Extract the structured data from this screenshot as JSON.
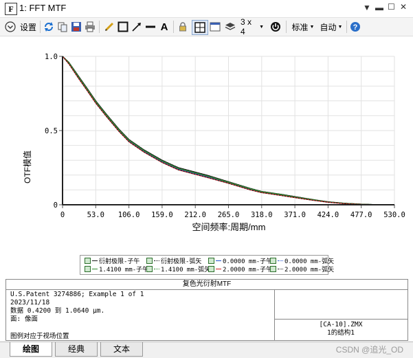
{
  "window": {
    "title": "1: FFT MTF",
    "icon_letter": "F"
  },
  "toolbar": {
    "settings_label": "设置",
    "layout_label": "3 x 4",
    "standard_label": "标准",
    "auto_label": "自动"
  },
  "chart_data": {
    "type": "line",
    "xlabel": "空间频率:周期/mm",
    "ylabel": "OTF模值",
    "xlim": [
      0,
      530
    ],
    "ylim": [
      0,
      1.0
    ],
    "x_ticks": [
      "0",
      "53.0",
      "106.0",
      "159.0",
      "212.0",
      "265.0",
      "318.0",
      "371.0",
      "424.0",
      "477.0",
      "530.0"
    ],
    "y_ticks": [
      "0",
      "0.5",
      "1.0"
    ],
    "grid": true,
    "x": [
      0,
      10,
      25,
      40,
      53,
      70,
      90,
      106,
      130,
      159,
      185,
      212,
      230,
      265,
      300,
      318,
      350,
      371,
      400,
      424,
      450,
      477,
      500,
      515,
      530
    ],
    "series": [
      {
        "name": "衍射极限-子午",
        "color": "#1a1a1a",
        "style": "solid",
        "values": [
          1.0,
          0.96,
          0.87,
          0.78,
          0.7,
          0.61,
          0.51,
          0.44,
          0.37,
          0.3,
          0.25,
          0.22,
          0.2,
          0.155,
          0.11,
          0.09,
          0.07,
          0.055,
          0.035,
          0.02,
          0.01,
          0.004,
          0.001,
          0.0,
          0.0
        ]
      },
      {
        "name": "衍射极限-弧矢",
        "color": "#1a1a1a",
        "style": "dotted",
        "values": [
          1.0,
          0.96,
          0.87,
          0.78,
          0.7,
          0.61,
          0.51,
          0.44,
          0.37,
          0.3,
          0.25,
          0.22,
          0.2,
          0.155,
          0.11,
          0.09,
          0.07,
          0.055,
          0.035,
          0.02,
          0.01,
          0.004,
          0.001,
          0.0,
          0.0
        ]
      },
      {
        "name": "0.0000 mm-子午",
        "color": "#1f4fd0",
        "style": "solid",
        "values": [
          1.0,
          0.955,
          0.86,
          0.77,
          0.69,
          0.6,
          0.5,
          0.43,
          0.36,
          0.29,
          0.24,
          0.21,
          0.19,
          0.15,
          0.105,
          0.085,
          0.065,
          0.05,
          0.032,
          0.018,
          0.009,
          0.003,
          0.001,
          0.0,
          0.0
        ]
      },
      {
        "name": "0.0000 mm-弧矢",
        "color": "#1f4fd0",
        "style": "dotted",
        "values": [
          1.0,
          0.955,
          0.86,
          0.77,
          0.69,
          0.6,
          0.5,
          0.43,
          0.36,
          0.29,
          0.24,
          0.21,
          0.19,
          0.15,
          0.105,
          0.085,
          0.065,
          0.05,
          0.032,
          0.018,
          0.009,
          0.003,
          0.001,
          0.0,
          0.0
        ]
      },
      {
        "name": "1.4100 mm-子午",
        "color": "#2e8b2e",
        "style": "solid",
        "values": [
          1.0,
          0.958,
          0.865,
          0.775,
          0.695,
          0.605,
          0.505,
          0.435,
          0.365,
          0.295,
          0.245,
          0.215,
          0.195,
          0.152,
          0.108,
          0.088,
          0.068,
          0.052,
          0.034,
          0.019,
          0.01,
          0.004,
          0.001,
          0.0,
          0.0
        ]
      },
      {
        "name": "1.4100 mm-弧矢",
        "color": "#2e8b2e",
        "style": "dotted",
        "values": [
          1.0,
          0.958,
          0.865,
          0.775,
          0.695,
          0.605,
          0.505,
          0.435,
          0.365,
          0.295,
          0.245,
          0.215,
          0.195,
          0.152,
          0.108,
          0.088,
          0.068,
          0.052,
          0.034,
          0.019,
          0.01,
          0.004,
          0.001,
          0.0,
          0.0
        ]
      },
      {
        "name": "2.0000 mm-子午",
        "color": "#d11f1f",
        "style": "solid",
        "values": [
          1.0,
          0.95,
          0.855,
          0.765,
          0.685,
          0.595,
          0.495,
          0.425,
          0.355,
          0.285,
          0.235,
          0.205,
          0.185,
          0.145,
          0.1,
          0.082,
          0.062,
          0.048,
          0.03,
          0.017,
          0.008,
          0.003,
          0.001,
          0.0,
          0.0
        ]
      },
      {
        "name": "2.0000 mm-弧矢",
        "color": "#222222",
        "style": "dotted",
        "values": [
          1.0,
          0.95,
          0.855,
          0.765,
          0.685,
          0.595,
          0.495,
          0.425,
          0.355,
          0.285,
          0.235,
          0.205,
          0.185,
          0.145,
          0.1,
          0.082,
          0.062,
          0.048,
          0.03,
          0.017,
          0.008,
          0.003,
          0.001,
          0.0,
          0.0
        ]
      }
    ]
  },
  "info": {
    "heading": "复色光衍射MTF",
    "line1": "U.S.Patent 3274886; Example 1 of 1",
    "line2": "2023/11/18",
    "line3": "数据 0.4200 到 1.0640 μm.",
    "line4": "面: 像面",
    "footnote": "图例对应于视场位置",
    "file": "[CA-10].ZMX",
    "config": "1的结构1"
  },
  "tabs": [
    "绘图",
    "经典",
    "文本"
  ],
  "watermark": "CSDN @追光_OD"
}
